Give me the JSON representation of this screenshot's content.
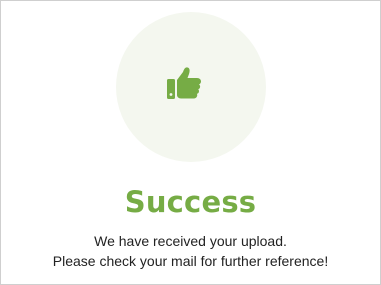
{
  "dialog": {
    "icon": "thumbs-up-icon",
    "accent_color": "#76ac45",
    "circle_color": "#f4f7ef",
    "title": "Success",
    "message_line1": "We have received your upload.",
    "message_line2": "Please check your mail for further reference!"
  }
}
